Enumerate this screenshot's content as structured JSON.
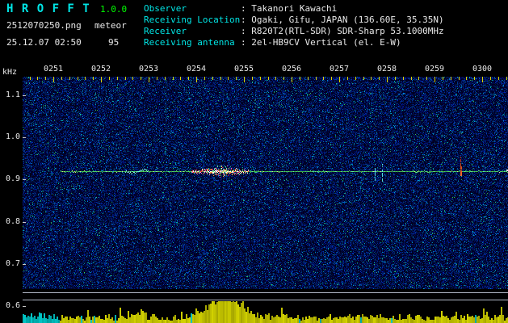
{
  "header": {
    "app_name": "H R O F F T",
    "version": "1.0.0",
    "filename": "2512070250.png",
    "mode": "meteor",
    "datetime": "25.12.07 02:50",
    "count": "95",
    "info": [
      {
        "label": "Observer",
        "value": "Takanori Kawachi"
      },
      {
        "label": "Receiving Location",
        "value": "Ogaki, Gifu, JAPAN (136.60E, 35.35N)"
      },
      {
        "label": "Receiver",
        "value": "R820T2(RTL-SDR) SDR-Sharp 53.1000MHz"
      },
      {
        "label": "Receiving antenna",
        "value": "2el-HB9CV Vertical (el. E-W)"
      }
    ]
  },
  "chart_data": {
    "type": "heatmap",
    "subtype": "meteor-radio-spectrogram",
    "title": "",
    "ylabel": "kHz",
    "ytick_labels": [
      "1.1",
      "1.0",
      "0.9",
      "0.8",
      "0.7",
      "0.6"
    ],
    "ytick_khz": [
      1.1,
      1.0,
      0.9,
      0.8,
      0.7,
      0.6
    ],
    "ylim_khz": [
      0.6,
      1.14
    ],
    "xlabel_ticks": [
      "0251",
      "0252",
      "0253",
      "0254",
      "0255",
      "0256",
      "0257",
      "0258",
      "0259",
      "0300"
    ],
    "grid": false,
    "legend": false,
    "carrier_khz": 0.92,
    "events": [
      {
        "type": "carrier-line",
        "khz": 0.92,
        "start": "0251.15",
        "end": "0300.6",
        "palette": [
          "#3aa848",
          "#50d060",
          "#5ce8a0",
          "#c8f080"
        ]
      },
      {
        "type": "faint-vertical-line",
        "time": "0253.35",
        "khz_from": 0.92,
        "khz_to": 1.14,
        "color": "#0a4a66"
      },
      {
        "type": "drift-wiggle",
        "khz": 0.92,
        "start": "0252.5",
        "end": "0253.0",
        "palette": [
          "#70ffd0",
          "#a0ffe8"
        ]
      },
      {
        "type": "meteor-echo-burst",
        "khz": 0.92,
        "start": "0253.9",
        "end": "0255.1",
        "colors": [
          "#ffffff",
          "#ff70c8",
          "#ff3830",
          "#ffe860",
          "#70ff80",
          "#ffa040"
        ]
      },
      {
        "type": "spike",
        "khz": 0.92,
        "time": "0257.75",
        "color": "#50dce0"
      },
      {
        "type": "spike",
        "khz": 0.92,
        "time": "0257.9",
        "color": "#50dce0"
      },
      {
        "type": "vertical-streak",
        "time": "0259.55",
        "khz_from": 0.915,
        "khz_to": 0.955,
        "color": "#e05020"
      }
    ],
    "signal_level_strip": {
      "peak_time": "0254.6",
      "secondary_peak_time": "0252.85",
      "bar_color": "#d4d400",
      "alt_bar_color": "#00c8c8",
      "reference_line_color": "#b4bac8"
    }
  },
  "colors": {
    "cyan_text": "#00e5e5",
    "green_text": "#00ff00",
    "white_text": "#e8e8e8",
    "tick_yellow": "#d8d800",
    "axis_tick": "#c8c8c8",
    "plot_bg": "#000020"
  }
}
